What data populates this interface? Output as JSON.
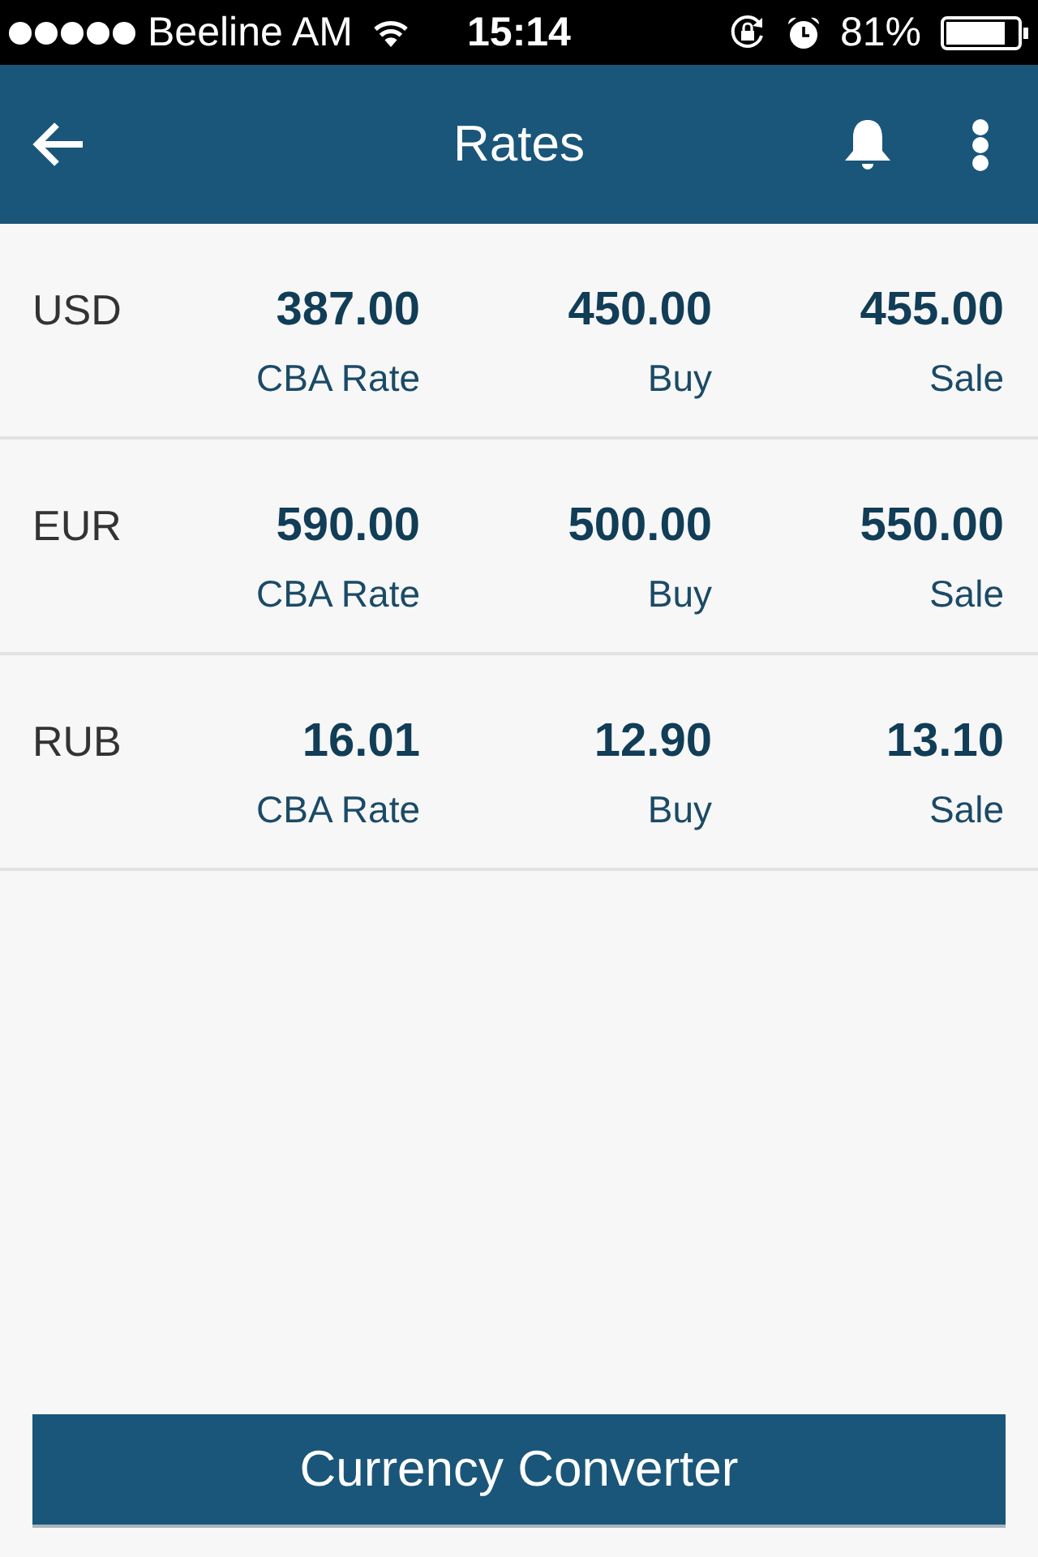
{
  "status_bar": {
    "carrier": "Beeline AM",
    "time": "15:14",
    "battery": "81%"
  },
  "app_bar": {
    "title": "Rates"
  },
  "rates": [
    {
      "code": "USD",
      "cells": [
        {
          "value": "387.00",
          "label": "CBA Rate"
        },
        {
          "value": "450.00",
          "label": "Buy"
        },
        {
          "value": "455.00",
          "label": "Sale"
        }
      ]
    },
    {
      "code": "EUR",
      "cells": [
        {
          "value": "590.00",
          "label": "CBA Rate"
        },
        {
          "value": "500.00",
          "label": "Buy"
        },
        {
          "value": "550.00",
          "label": "Sale"
        }
      ]
    },
    {
      "code": "RUB",
      "cells": [
        {
          "value": "16.01",
          "label": "CBA Rate"
        },
        {
          "value": "12.90",
          "label": "Buy"
        },
        {
          "value": "13.10",
          "label": "Sale"
        }
      ]
    }
  ],
  "button": {
    "label": "Currency Converter"
  }
}
